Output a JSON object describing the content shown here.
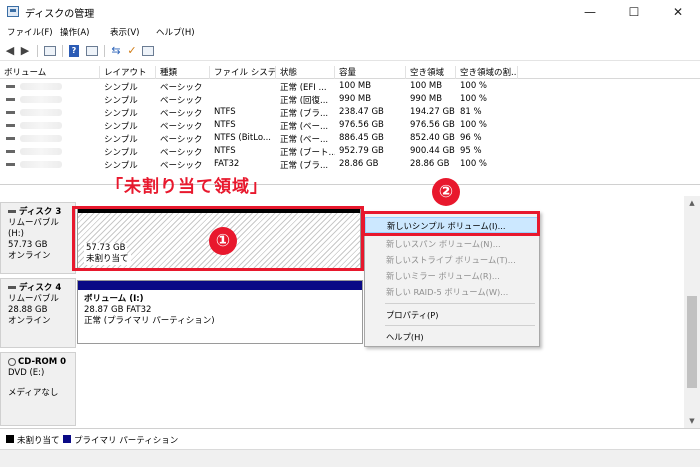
{
  "window": {
    "title": "ディスクの管理"
  },
  "menu": [
    "ファイル(F)",
    "操作(A)",
    "表示(V)",
    "ヘルプ(H)"
  ],
  "volume_table": {
    "columns": [
      "ボリューム",
      "レイアウト",
      "種類",
      "ファイル システム",
      "状態",
      "容量",
      "空き領域",
      "空き領域の割..."
    ],
    "rows": [
      {
        "layout": "シンプル",
        "type": "ベーシック",
        "fs": "",
        "status": "正常 (EFI ...",
        "capacity": "100 MB",
        "free": "100 MB",
        "pct": "100 %"
      },
      {
        "layout": "シンプル",
        "type": "ベーシック",
        "fs": "",
        "status": "正常 (回復...",
        "capacity": "990 MB",
        "free": "990 MB",
        "pct": "100 %"
      },
      {
        "layout": "シンプル",
        "type": "ベーシック",
        "fs": "NTFS",
        "status": "正常 (ブラ...",
        "capacity": "238.47 GB",
        "free": "194.27 GB",
        "pct": "81 %"
      },
      {
        "layout": "シンプル",
        "type": "ベーシック",
        "fs": "NTFS",
        "status": "正常 (ベー...",
        "capacity": "976.56 GB",
        "free": "976.56 GB",
        "pct": "100 %"
      },
      {
        "layout": "シンプル",
        "type": "ベーシック",
        "fs": "NTFS (BitLo...",
        "status": "正常 (ベー...",
        "capacity": "886.45 GB",
        "free": "852.40 GB",
        "pct": "96 %"
      },
      {
        "layout": "シンプル",
        "type": "ベーシック",
        "fs": "NTFS",
        "status": "正常 (ブート...",
        "capacity": "952.79 GB",
        "free": "900.44 GB",
        "pct": "95 %"
      },
      {
        "layout": "シンプル",
        "type": "ベーシック",
        "fs": "FAT32",
        "status": "正常 (ブラ...",
        "capacity": "28.86 GB",
        "free": "28.86 GB",
        "pct": "100 %"
      }
    ]
  },
  "disks": {
    "disk3": {
      "name": "ディスク 3",
      "media": "リムーバブル (H:)",
      "size": "57.73 GB",
      "state": "オンライン"
    },
    "disk3_part": {
      "size": "57.73 GB",
      "label": "未割り当て"
    },
    "disk4": {
      "name": "ディスク 4",
      "media": "リムーバブル",
      "size": "28.88 GB",
      "state": "オンライン"
    },
    "disk4_part": {
      "name": "ボリューム (I:)",
      "size": "28.87 GB FAT32",
      "status": "正常 (プライマリ パーティション)"
    },
    "cdrom": {
      "name": "CD-ROM 0",
      "drive": "DVD (E:)",
      "media": "メディアなし"
    }
  },
  "annotations": {
    "title": "「未割り当て領域」",
    "step1": "①",
    "step2": "②"
  },
  "context_menu": {
    "new_simple": "新しいシンプル ボリューム(I)...",
    "new_spanned": "新しいスパン ボリューム(N)...",
    "new_striped": "新しいストライプ ボリューム(T)...",
    "new_mirror": "新しいミラー ボリューム(R)...",
    "new_raid5": "新しい RAID-5 ボリューム(W)...",
    "properties": "プロパティ(P)",
    "help": "ヘルプ(H)"
  },
  "legend": {
    "unallocated": "未割り当て",
    "primary": "プライマリ パーティション"
  },
  "colors": {
    "accent_red": "#e8182d",
    "primary_partition": "#0a0a86",
    "highlight": "#cce8ff"
  }
}
